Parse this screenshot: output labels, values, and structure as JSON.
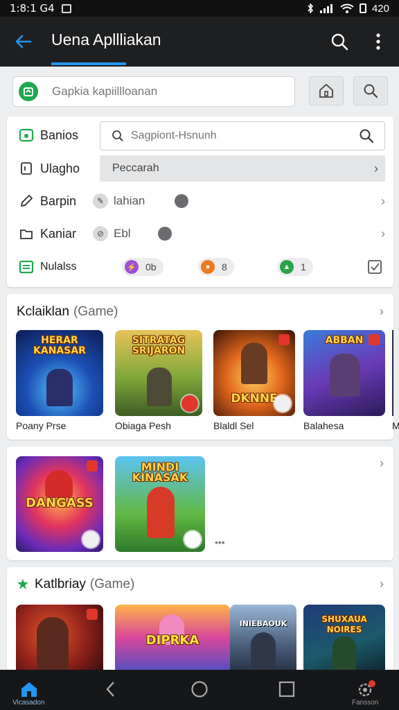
{
  "status_bar": {
    "time": "1:8:1 G4",
    "battery": "420"
  },
  "app_bar": {
    "title": "Uena Apllliakan"
  },
  "search": {
    "placeholder": "Gapkia kapiillloanan"
  },
  "filter_card": {
    "rows": [
      {
        "label": "Banios"
      },
      {
        "label": "Ulagho"
      },
      {
        "label": "Barpin"
      },
      {
        "label": "Kaniar"
      },
      {
        "label": "Nulalss"
      }
    ],
    "search_placeholder": "Sagpiont-Hsnunh",
    "select_value": "Peccarah",
    "chip_row3": {
      "text": "lahian"
    },
    "chip_row4": {
      "text": "Ebl"
    },
    "pills": [
      {
        "value": "0b",
        "color": "#9b52d8"
      },
      {
        "value": "8",
        "color": "#f07a1e"
      },
      {
        "value": "1",
        "color": "#2ca24a"
      }
    ]
  },
  "section1": {
    "title": "Kclaiklan",
    "subtitle": "(Game)",
    "tiles": [
      {
        "banner": "HERAR KANASAR",
        "caption": "Poany Prse"
      },
      {
        "banner": "SITRATAG SRIJARON",
        "caption": "Obiaga Pesh"
      },
      {
        "banner": "DKNNE",
        "caption": "Blaldl Sel"
      },
      {
        "banner": "ABBAN",
        "caption": "Balahesa"
      },
      {
        "banner": "",
        "caption": "M"
      }
    ]
  },
  "section2": {
    "tiles": [
      {
        "banner": "DANGASS",
        "caption": ""
      },
      {
        "banner": "MINDI KINASAK",
        "caption": ""
      }
    ],
    "more": "•••"
  },
  "section3": {
    "title": "Katlbriay",
    "subtitle": "(Game)",
    "tiles": [
      {
        "banner": ""
      },
      {
        "banner": "DIPRKA"
      },
      {
        "banner": "INIEBAOUK"
      },
      {
        "banner": "SHUXAUA NOIRES"
      }
    ]
  },
  "nav": {
    "home_label": "Vicasadon",
    "settings_label": "Fansson"
  },
  "colors": {
    "accent": "#2196f3",
    "green": "#1fa84f",
    "app_bar": "#1e1f21"
  }
}
